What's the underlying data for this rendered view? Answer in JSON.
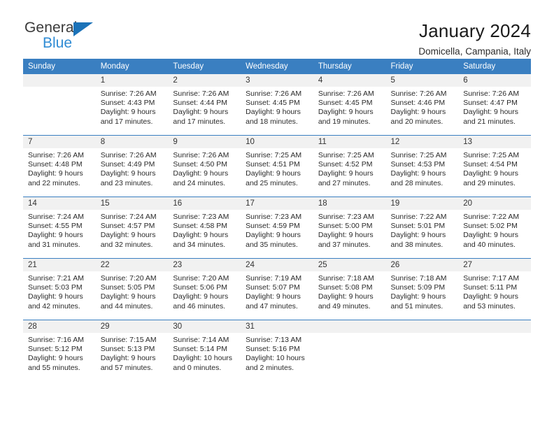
{
  "brand": {
    "name_part1": "General",
    "name_part2": "Blue",
    "accent_color": "#1b72b8",
    "accent_light": "#2e8bd4"
  },
  "header": {
    "title": "January 2024",
    "subtitle": "Domicella, Campania, Italy"
  },
  "theme": {
    "header_bg": "#3a7fc1",
    "daynum_bg": "#f1f1f1"
  },
  "weekdays": [
    "Sunday",
    "Monday",
    "Tuesday",
    "Wednesday",
    "Thursday",
    "Friday",
    "Saturday"
  ],
  "weeks": [
    [
      {
        "day": "",
        "l1": "",
        "l2": "",
        "l3": "",
        "l4": ""
      },
      {
        "day": "1",
        "l1": "Sunrise: 7:26 AM",
        "l2": "Sunset: 4:43 PM",
        "l3": "Daylight: 9 hours",
        "l4": "and 17 minutes."
      },
      {
        "day": "2",
        "l1": "Sunrise: 7:26 AM",
        "l2": "Sunset: 4:44 PM",
        "l3": "Daylight: 9 hours",
        "l4": "and 17 minutes."
      },
      {
        "day": "3",
        "l1": "Sunrise: 7:26 AM",
        "l2": "Sunset: 4:45 PM",
        "l3": "Daylight: 9 hours",
        "l4": "and 18 minutes."
      },
      {
        "day": "4",
        "l1": "Sunrise: 7:26 AM",
        "l2": "Sunset: 4:45 PM",
        "l3": "Daylight: 9 hours",
        "l4": "and 19 minutes."
      },
      {
        "day": "5",
        "l1": "Sunrise: 7:26 AM",
        "l2": "Sunset: 4:46 PM",
        "l3": "Daylight: 9 hours",
        "l4": "and 20 minutes."
      },
      {
        "day": "6",
        "l1": "Sunrise: 7:26 AM",
        "l2": "Sunset: 4:47 PM",
        "l3": "Daylight: 9 hours",
        "l4": "and 21 minutes."
      }
    ],
    [
      {
        "day": "7",
        "l1": "Sunrise: 7:26 AM",
        "l2": "Sunset: 4:48 PM",
        "l3": "Daylight: 9 hours",
        "l4": "and 22 minutes."
      },
      {
        "day": "8",
        "l1": "Sunrise: 7:26 AM",
        "l2": "Sunset: 4:49 PM",
        "l3": "Daylight: 9 hours",
        "l4": "and 23 minutes."
      },
      {
        "day": "9",
        "l1": "Sunrise: 7:26 AM",
        "l2": "Sunset: 4:50 PM",
        "l3": "Daylight: 9 hours",
        "l4": "and 24 minutes."
      },
      {
        "day": "10",
        "l1": "Sunrise: 7:25 AM",
        "l2": "Sunset: 4:51 PM",
        "l3": "Daylight: 9 hours",
        "l4": "and 25 minutes."
      },
      {
        "day": "11",
        "l1": "Sunrise: 7:25 AM",
        "l2": "Sunset: 4:52 PM",
        "l3": "Daylight: 9 hours",
        "l4": "and 27 minutes."
      },
      {
        "day": "12",
        "l1": "Sunrise: 7:25 AM",
        "l2": "Sunset: 4:53 PM",
        "l3": "Daylight: 9 hours",
        "l4": "and 28 minutes."
      },
      {
        "day": "13",
        "l1": "Sunrise: 7:25 AM",
        "l2": "Sunset: 4:54 PM",
        "l3": "Daylight: 9 hours",
        "l4": "and 29 minutes."
      }
    ],
    [
      {
        "day": "14",
        "l1": "Sunrise: 7:24 AM",
        "l2": "Sunset: 4:55 PM",
        "l3": "Daylight: 9 hours",
        "l4": "and 31 minutes."
      },
      {
        "day": "15",
        "l1": "Sunrise: 7:24 AM",
        "l2": "Sunset: 4:57 PM",
        "l3": "Daylight: 9 hours",
        "l4": "and 32 minutes."
      },
      {
        "day": "16",
        "l1": "Sunrise: 7:23 AM",
        "l2": "Sunset: 4:58 PM",
        "l3": "Daylight: 9 hours",
        "l4": "and 34 minutes."
      },
      {
        "day": "17",
        "l1": "Sunrise: 7:23 AM",
        "l2": "Sunset: 4:59 PM",
        "l3": "Daylight: 9 hours",
        "l4": "and 35 minutes."
      },
      {
        "day": "18",
        "l1": "Sunrise: 7:23 AM",
        "l2": "Sunset: 5:00 PM",
        "l3": "Daylight: 9 hours",
        "l4": "and 37 minutes."
      },
      {
        "day": "19",
        "l1": "Sunrise: 7:22 AM",
        "l2": "Sunset: 5:01 PM",
        "l3": "Daylight: 9 hours",
        "l4": "and 38 minutes."
      },
      {
        "day": "20",
        "l1": "Sunrise: 7:22 AM",
        "l2": "Sunset: 5:02 PM",
        "l3": "Daylight: 9 hours",
        "l4": "and 40 minutes."
      }
    ],
    [
      {
        "day": "21",
        "l1": "Sunrise: 7:21 AM",
        "l2": "Sunset: 5:03 PM",
        "l3": "Daylight: 9 hours",
        "l4": "and 42 minutes."
      },
      {
        "day": "22",
        "l1": "Sunrise: 7:20 AM",
        "l2": "Sunset: 5:05 PM",
        "l3": "Daylight: 9 hours",
        "l4": "and 44 minutes."
      },
      {
        "day": "23",
        "l1": "Sunrise: 7:20 AM",
        "l2": "Sunset: 5:06 PM",
        "l3": "Daylight: 9 hours",
        "l4": "and 46 minutes."
      },
      {
        "day": "24",
        "l1": "Sunrise: 7:19 AM",
        "l2": "Sunset: 5:07 PM",
        "l3": "Daylight: 9 hours",
        "l4": "and 47 minutes."
      },
      {
        "day": "25",
        "l1": "Sunrise: 7:18 AM",
        "l2": "Sunset: 5:08 PM",
        "l3": "Daylight: 9 hours",
        "l4": "and 49 minutes."
      },
      {
        "day": "26",
        "l1": "Sunrise: 7:18 AM",
        "l2": "Sunset: 5:09 PM",
        "l3": "Daylight: 9 hours",
        "l4": "and 51 minutes."
      },
      {
        "day": "27",
        "l1": "Sunrise: 7:17 AM",
        "l2": "Sunset: 5:11 PM",
        "l3": "Daylight: 9 hours",
        "l4": "and 53 minutes."
      }
    ],
    [
      {
        "day": "28",
        "l1": "Sunrise: 7:16 AM",
        "l2": "Sunset: 5:12 PM",
        "l3": "Daylight: 9 hours",
        "l4": "and 55 minutes."
      },
      {
        "day": "29",
        "l1": "Sunrise: 7:15 AM",
        "l2": "Sunset: 5:13 PM",
        "l3": "Daylight: 9 hours",
        "l4": "and 57 minutes."
      },
      {
        "day": "30",
        "l1": "Sunrise: 7:14 AM",
        "l2": "Sunset: 5:14 PM",
        "l3": "Daylight: 10 hours",
        "l4": "and 0 minutes."
      },
      {
        "day": "31",
        "l1": "Sunrise: 7:13 AM",
        "l2": "Sunset: 5:16 PM",
        "l3": "Daylight: 10 hours",
        "l4": "and 2 minutes."
      },
      {
        "day": "",
        "l1": "",
        "l2": "",
        "l3": "",
        "l4": ""
      },
      {
        "day": "",
        "l1": "",
        "l2": "",
        "l3": "",
        "l4": ""
      },
      {
        "day": "",
        "l1": "",
        "l2": "",
        "l3": "",
        "l4": ""
      }
    ]
  ]
}
